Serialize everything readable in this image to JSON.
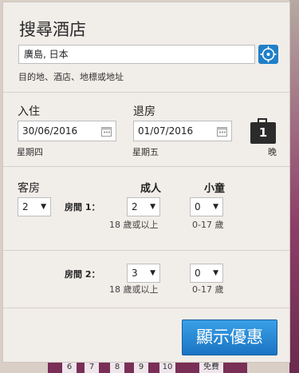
{
  "form": {
    "title": "搜尋酒店",
    "destination_value": "廣島, 日本",
    "destination_hint": "目的地、酒店、地標或地址",
    "checkin_label": "入住",
    "checkin_value": "30/06/2016",
    "checkin_day": "星期四",
    "checkout_label": "退房",
    "checkout_value": "01/07/2016",
    "checkout_day": "星期五",
    "nights_value": "1",
    "nights_label": "晚",
    "rooms_label": "客房",
    "rooms_value": "2",
    "adults_header": "成人",
    "children_header": "小童",
    "room1_label": "房間 1：",
    "room1_adults": "2",
    "room1_children": "0",
    "room2_label": "房間 2：",
    "room2_adults": "3",
    "room2_children": "0",
    "adults_range": "18 歲或以上",
    "children_range": "0-17 歲",
    "submit_label": "顯示優惠"
  },
  "background": {
    "calendar_digits": [
      "6",
      "7",
      "8",
      "9",
      "10"
    ],
    "free_label": "免費"
  },
  "colors": {
    "accent": "#1f7fc8",
    "panel": "#f1ede9"
  },
  "icons": {
    "location": "crosshair-icon",
    "calendar": "calendar-icon",
    "nights": "suitcase-icon",
    "dropdown": "triangle-down"
  }
}
